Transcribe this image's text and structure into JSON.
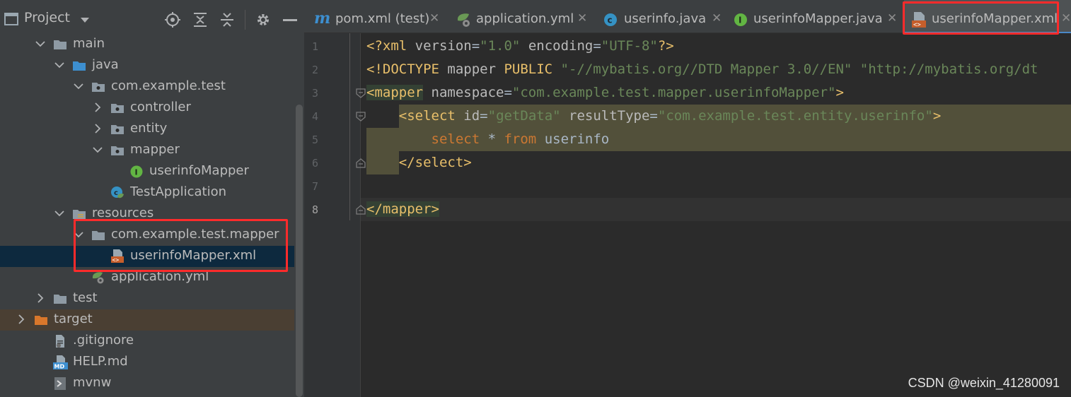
{
  "project_panel": {
    "title": "Project",
    "tree": [
      {
        "label": "main",
        "depth": 1,
        "expanded": true,
        "icon": "folder-icon"
      },
      {
        "label": "java",
        "depth": 2,
        "expanded": true,
        "icon": "source-folder-icon"
      },
      {
        "label": "com.example.test",
        "depth": 3,
        "expanded": true,
        "icon": "package-icon"
      },
      {
        "label": "controller",
        "depth": 4,
        "expanded": false,
        "icon": "package-icon"
      },
      {
        "label": "entity",
        "depth": 4,
        "expanded": false,
        "icon": "package-icon"
      },
      {
        "label": "mapper",
        "depth": 4,
        "expanded": true,
        "icon": "package-icon"
      },
      {
        "label": "userinfoMapper",
        "depth": 5,
        "icon": "interface-icon"
      },
      {
        "label": "TestApplication",
        "depth": 4,
        "icon": "spring-class-icon"
      },
      {
        "label": "resources",
        "depth": 2,
        "expanded": true,
        "icon": "resources-folder-icon"
      },
      {
        "label": "com.example.test.mapper",
        "depth": 3,
        "expanded": true,
        "icon": "folder-icon"
      },
      {
        "label": "userinfoMapper.xml",
        "depth": 4,
        "icon": "xml-file-icon"
      },
      {
        "label": "application.yml",
        "depth": 3,
        "icon": "yml-file-icon"
      },
      {
        "label": "test",
        "depth": 1,
        "expanded": false,
        "icon": "folder-icon"
      },
      {
        "label": "target",
        "depth": 0,
        "expanded": false,
        "icon": "excluded-folder-icon"
      },
      {
        "label": ".gitignore",
        "depth": 1,
        "icon": "text-file-icon"
      },
      {
        "label": "HELP.md",
        "depth": 1,
        "icon": "markdown-file-icon"
      },
      {
        "label": "mvnw",
        "depth": 1,
        "icon": "script-file-icon"
      }
    ]
  },
  "tabs": [
    {
      "label": "pom.xml (test)",
      "icon": "maven-icon"
    },
    {
      "label": "application.yml",
      "icon": "yml-file-icon"
    },
    {
      "label": "userinfo.java",
      "icon": "class-icon"
    },
    {
      "label": "userinfoMapper.java",
      "icon": "interface-icon"
    },
    {
      "label": "userinfoMapper.xml",
      "icon": "xml-file-icon",
      "active": true
    }
  ],
  "editor": {
    "line_numbers": [
      "1",
      "2",
      "3",
      "4",
      "5",
      "6",
      "7",
      "8"
    ],
    "current_line": "8",
    "code": {
      "l1": [
        "<?xml ",
        "version",
        "=",
        "\"1.0\"",
        " encoding",
        "=",
        "\"UTF-8\"",
        "?>"
      ],
      "l2": [
        "<!DOCTYPE ",
        "mapper ",
        "PUBLIC ",
        "\"-//mybatis.org//DTD Mapper 3.0//EN\" ",
        "\"http://mybatis.org/dt"
      ],
      "l3": [
        "<mapper",
        " namespace",
        "=",
        "\"com.example.test.mapper.userinfoMapper\"",
        ">"
      ],
      "l4": [
        "    ",
        "<select",
        " id",
        "=",
        "\"getData\"",
        " resultType",
        "=",
        "\"com.example.test.entity.userinfo\"",
        ">"
      ],
      "l5": [
        "        ",
        "select",
        " * ",
        "from",
        " userinfo"
      ],
      "l6": [
        "    ",
        "</select>"
      ],
      "l7": [
        ""
      ],
      "l8": [
        "</mapper>"
      ]
    }
  },
  "watermark": "CSDN @weixin_41280091"
}
